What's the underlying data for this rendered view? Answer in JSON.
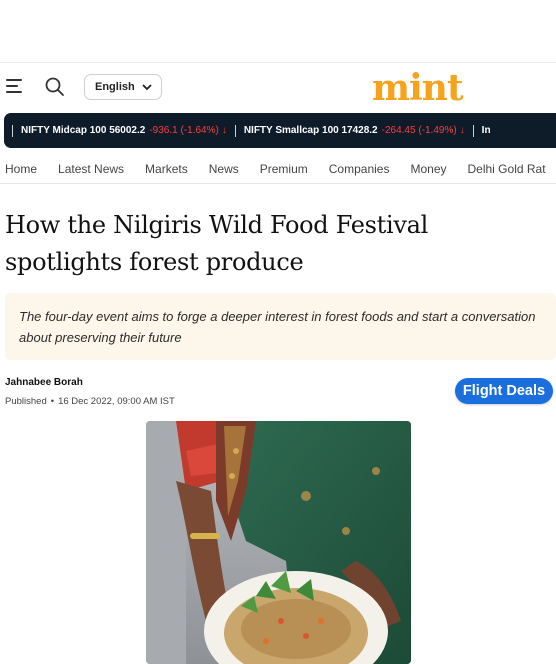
{
  "header": {
    "language": "English",
    "logo": "mint"
  },
  "ticker": [
    {
      "name": "NIFTY Midcap 100",
      "value": "56002.2",
      "change": "-936.1 (-1.64%)"
    },
    {
      "name": "NIFTY Smallcap 100",
      "value": "17428.2",
      "change": "-264.45 (-1.49%)"
    },
    {
      "name": "In",
      "value": "",
      "change": ""
    }
  ],
  "nav": [
    "Home",
    "Latest News",
    "Markets",
    "News",
    "Premium",
    "Companies",
    "Money",
    "Delhi Gold Rat"
  ],
  "article": {
    "headline": "How the Nilgiris Wild Food Festival spotlights forest produce",
    "summary": "The four-day event aims to forge a deeper interest in forest foods and start a conversation about preserving their future",
    "author": "Jahnabee Borah",
    "published_label": "Published",
    "published_date": "16 Dec 2022, 09:00 AM IST"
  },
  "ad": {
    "flight_deals": "Flight Deals"
  },
  "colors": {
    "logo": "#f7a21b",
    "ticker_bg": "#0e1c2a",
    "negative": "#ff3b3b",
    "flight_button": "#1a6fdc",
    "summary_bg": "#fdf6ea"
  },
  "icons": [
    "hamburger-menu-icon",
    "search-icon",
    "chevron-down-icon",
    "down-arrow-icon"
  ]
}
